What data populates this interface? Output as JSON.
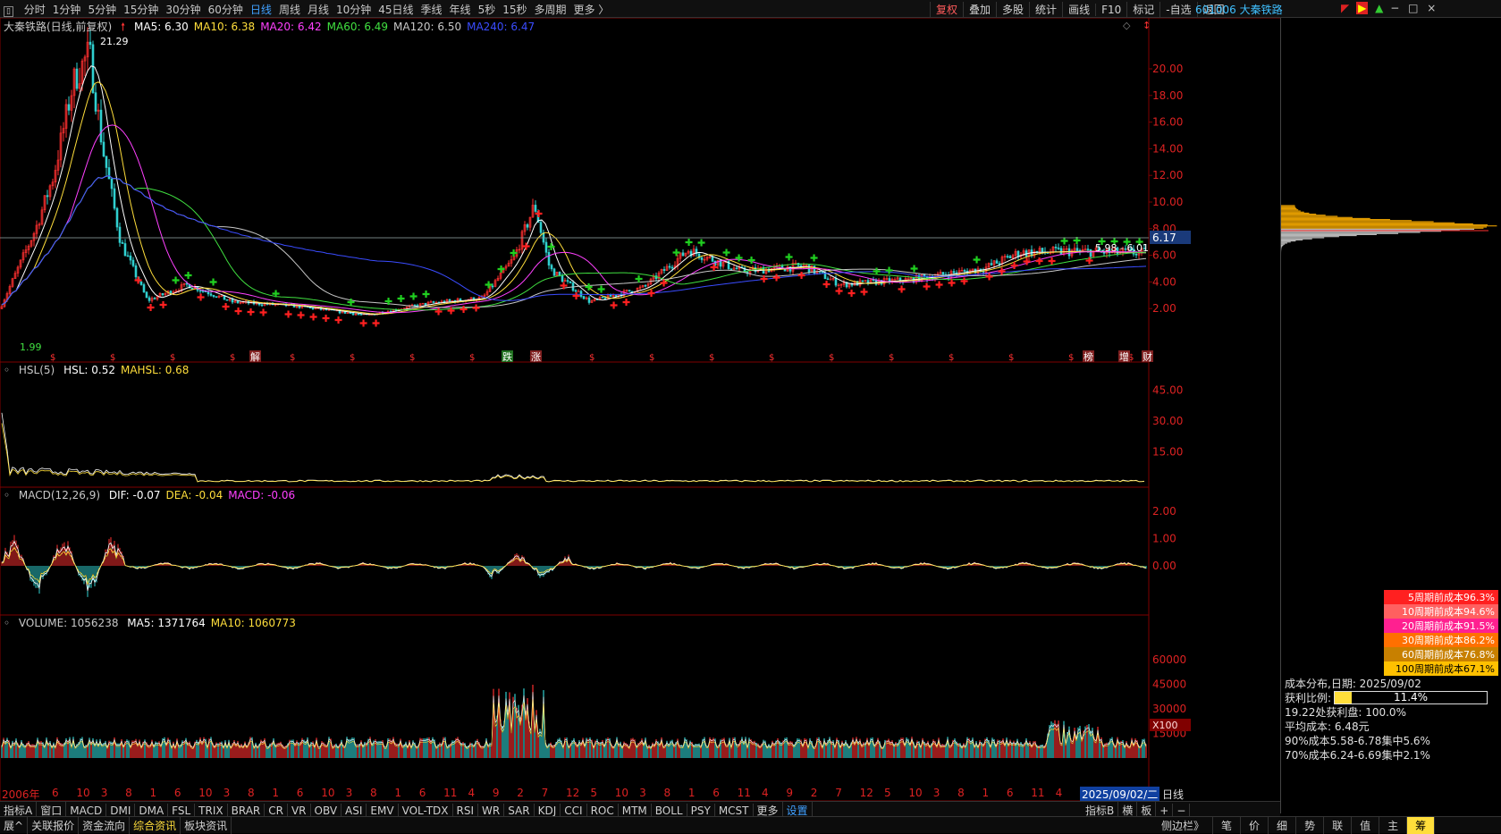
{
  "toolbar": {
    "periods": [
      "分时",
      "1分钟",
      "5分钟",
      "15分钟",
      "30分钟",
      "60分钟",
      "日线",
      "周线",
      "月线",
      "10分钟",
      "45日线",
      "季线",
      "年线",
      "5秒",
      "15秒",
      "多周期",
      "更多 〉"
    ],
    "active_period": "日线",
    "right_buttons": [
      "复权",
      "叠加",
      "多股",
      "统计",
      "画线",
      "F10",
      "标记",
      "-自选",
      "返回"
    ],
    "active_right": "复权",
    "stock_header": "601006 大秦铁路"
  },
  "main_chart": {
    "title": "大秦铁路(日线,前复权)",
    "ma": [
      {
        "label": "MA5: 6.30",
        "color": "#ffffff"
      },
      {
        "label": "MA10: 6.38",
        "color": "#ffde3b"
      },
      {
        "label": "MA20: 6.42",
        "color": "#ff40ff"
      },
      {
        "label": "MA60: 6.49",
        "color": "#40e040"
      },
      {
        "label": "MA120: 6.50",
        "color": "#c8c8c8"
      },
      {
        "label": "MA240: 6.47",
        "color": "#3a4cff"
      }
    ],
    "high_label": "21.29",
    "low_label": "1.99",
    "current_price": "6.17",
    "range_label": "5.98 - 6.01",
    "y_ticks": [
      "20.00",
      "18.00",
      "16.00",
      "14.00",
      "12.00",
      "10.00",
      "8.00",
      "6.00",
      "4.00",
      "2.00"
    ],
    "event_markers": [
      "解",
      "跌",
      "涨",
      "榜",
      "增",
      "财"
    ]
  },
  "hsl_panel": {
    "title": "HSL(5)",
    "values": [
      {
        "label": "HSL: 0.52",
        "color": "#ffffff"
      },
      {
        "label": "MAHSL: 0.68",
        "color": "#ffde3b"
      }
    ],
    "y_ticks": [
      "45.00",
      "30.00",
      "15.00"
    ]
  },
  "macd_panel": {
    "title": "MACD(12,26,9)",
    "values": [
      {
        "label": "DIF: -0.07",
        "color": "#ffffff"
      },
      {
        "label": "DEA: -0.04",
        "color": "#ffde3b"
      },
      {
        "label": "MACD: -0.06",
        "color": "#ff40ff"
      }
    ],
    "y_ticks": [
      "2.00",
      "1.00",
      "0.00"
    ]
  },
  "volume_panel": {
    "title": "VOLUME: 1056238",
    "values": [
      {
        "label": "MA5: 1371764",
        "color": "#ffffff"
      },
      {
        "label": "MA10: 1060773",
        "color": "#ffde3b"
      }
    ],
    "y_ticks": [
      "60000",
      "45000",
      "30000",
      "15000"
    ],
    "unit": "X100"
  },
  "x_axis": {
    "first": "2006年",
    "labels": [
      "6",
      "10",
      "3",
      "8",
      "1",
      "6",
      "10",
      "3",
      "8",
      "1",
      "6",
      "10",
      "3",
      "8",
      "1",
      "6",
      "11",
      "4",
      "9",
      "2",
      "7",
      "12",
      "5",
      "10",
      "3",
      "8",
      "1",
      "6",
      "11",
      "4",
      "9",
      "2",
      "7",
      "12",
      "5",
      "10",
      "3",
      "8",
      "1",
      "6",
      "11",
      "4"
    ],
    "last": "2025/09/02/二",
    "period": "日线"
  },
  "cost_distribution": {
    "rows": [
      {
        "label": "5周期前成本96.3%",
        "color": "#ff2020"
      },
      {
        "label": "10周期前成本94.6%",
        "color": "#ff6060"
      },
      {
        "label": "20周期前成本91.5%",
        "color": "#ff2090"
      },
      {
        "label": "30周期前成本86.2%",
        "color": "#ff7000"
      },
      {
        "label": "60周期前成本76.8%",
        "color": "#c88000"
      },
      {
        "label": "100周期前成本67.1%",
        "color": "#ffc000"
      }
    ],
    "date_line": "成本分布,日期:  2025/09/02",
    "profit_label": "获利比例:",
    "profit_value": "11.4%",
    "profit_ratio": 0.114,
    "profit_at": "19.22处获利盘:  100.0%",
    "avg_cost": "平均成本:  6.48元",
    "c90": "90%成本5.58-6.78集中5.6%",
    "c70": "70%成本6.24-6.69集中2.1%"
  },
  "indicator_tabs": [
    "指标A",
    "窗口",
    "MACD",
    "DMI",
    "DMA",
    "FSL",
    "TRIX",
    "BRAR",
    "CR",
    "VR",
    "OBV",
    "ASI",
    "EMV",
    "VOL-TDX",
    "RSI",
    "WR",
    "SAR",
    "KDJ",
    "CCI",
    "ROC",
    "MTM",
    "BOLL",
    "PSY",
    "MCST",
    "更多",
    "设置"
  ],
  "indicator_right": [
    "指标B",
    "横",
    "板",
    "+",
    "−"
  ],
  "status_tabs": [
    "展^",
    "关联报价",
    "资金流向",
    "综合资讯",
    "板块资讯"
  ],
  "active_status": "综合资讯",
  "right_status": [
    "侧边栏》",
    "笔",
    "价",
    "细",
    "势",
    "联",
    "值",
    "主",
    "筹"
  ],
  "active_right_status": "筹"
}
